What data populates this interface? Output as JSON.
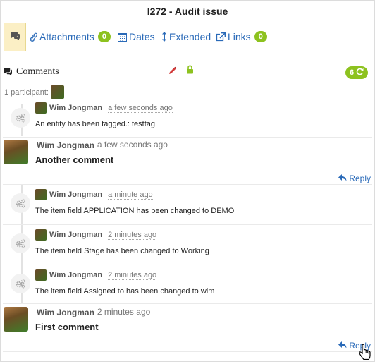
{
  "title": "I272 - Audit issue",
  "tabs": {
    "comments_icon": "comments-icon",
    "attachments_label": "Attachments",
    "attachments_count": "0",
    "dates_label": "Dates",
    "extended_label": "Extended",
    "links_label": "Links",
    "links_count": "0"
  },
  "comments": {
    "heading": "Comments",
    "count": "6",
    "participants": "1 participant:"
  },
  "events": [
    {
      "author": "Wim Jongman",
      "time": "a few seconds ago",
      "text": "An entity has been tagged.: testtag"
    },
    {
      "author": "Wim Jongman",
      "time": "a minute ago",
      "text": "The item field APPLICATION has been changed to DEMO"
    },
    {
      "author": "Wim Jongman",
      "time": "2 minutes ago",
      "text": "The item field Stage has been changed to Working"
    },
    {
      "author": "Wim Jongman",
      "time": "2 minutes ago",
      "text": "The item field Assigned to has been changed to wim"
    }
  ],
  "user_comments": [
    {
      "author": "Wim Jongman",
      "time": "a few seconds ago",
      "text": "Another comment",
      "reply": "Reply"
    },
    {
      "author": "Wim Jongman",
      "time": "2 minutes ago",
      "text": "First comment",
      "reply": "Reply"
    }
  ],
  "colors": {
    "accent": "#2a6ab8",
    "badge": "#8dc21f",
    "active_tab": "#fbefc5"
  }
}
